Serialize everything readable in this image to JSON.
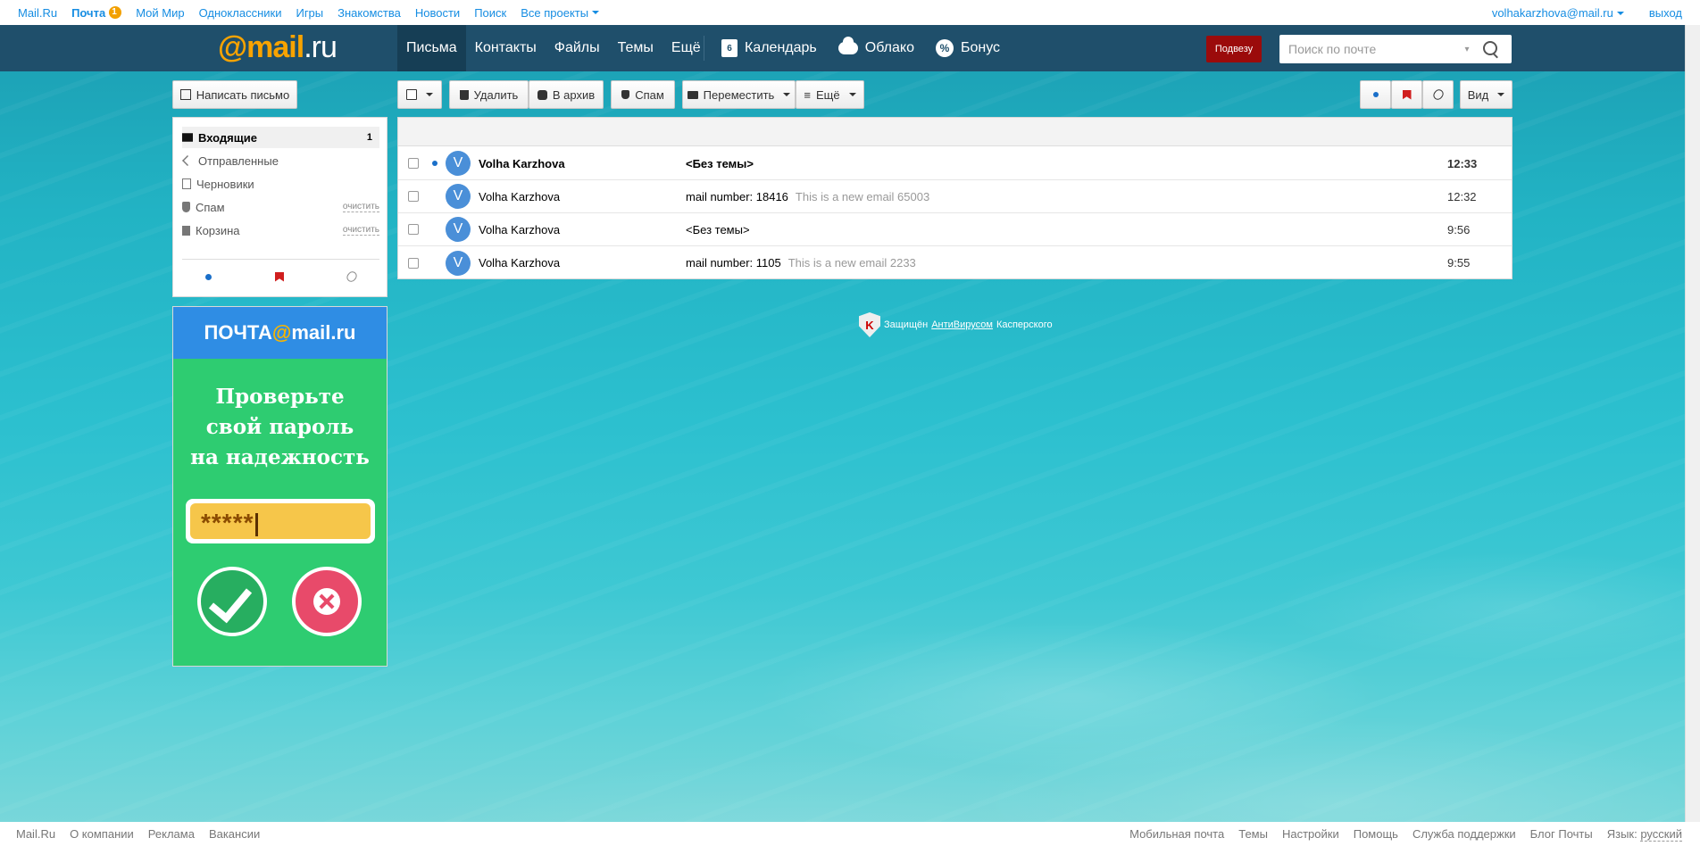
{
  "portal": {
    "links": [
      "Mail.Ru",
      "Почта",
      "Мой Мир",
      "Одноклассники",
      "Игры",
      "Знакомства",
      "Новости",
      "Поиск",
      "Все проекты"
    ],
    "mail_badge": "1",
    "user_email": "volhakarzhova@mail.ru",
    "logout": "выход"
  },
  "header": {
    "logo_mail": "mail",
    "logo_at": "@",
    "logo_ru": ".ru",
    "tabs": [
      "Письма",
      "Контакты",
      "Файлы",
      "Темы",
      "Ещё"
    ],
    "calendar": "Календарь",
    "calendar_day": "6",
    "cloud": "Облако",
    "bonus": "Бонус",
    "podvezu": "Подвезу",
    "search_placeholder": "Поиск по почте"
  },
  "toolbar": {
    "compose": "Написать письмо",
    "delete": "Удалить",
    "archive": "В архив",
    "spam": "Спам",
    "move": "Переместить",
    "more": "Ещё",
    "view": "Вид"
  },
  "folders": [
    {
      "label": "Входящие",
      "count": "1"
    },
    {
      "label": "Отправленные"
    },
    {
      "label": "Черновики"
    },
    {
      "label": "Спам",
      "action": "очистить"
    },
    {
      "label": "Корзина",
      "action": "очистить"
    }
  ],
  "ad": {
    "brand_left": "ПОЧТА",
    "brand_at": "@",
    "brand_right": "mail.ru",
    "line1": "Проверьте",
    "line2": "свой пароль",
    "line3": "на надежность",
    "password": "*****"
  },
  "messages": [
    {
      "avatar": "V",
      "from": "Volha Karzhova",
      "subject": "<Без темы>",
      "snippet": "",
      "time": "12:33",
      "unread": true
    },
    {
      "avatar": "V",
      "from": "Volha Karzhova",
      "subject": "mail number: 18416",
      "snippet": "This is a new email 65003",
      "time": "12:32",
      "unread": false
    },
    {
      "avatar": "V",
      "from": "Volha Karzhova",
      "subject": "<Без темы>",
      "snippet": "",
      "time": "9:56",
      "unread": false
    },
    {
      "avatar": "V",
      "from": "Volha Karzhova",
      "subject": "mail number: 1105",
      "snippet": "This is a new email 2233",
      "time": "9:55",
      "unread": false
    }
  ],
  "kaspersky": {
    "pre": "Защищён",
    "link": "АнтиВирусом",
    "post": "Касперского",
    "logo_letter": "K"
  },
  "footer": {
    "left": [
      "Mail.Ru",
      "О компании",
      "Реклама",
      "Вакансии"
    ],
    "right": [
      "Мобильная почта",
      "Темы",
      "Настройки",
      "Помощь",
      "Служба поддержки",
      "Блог Почты"
    ],
    "lang_label": "Язык:",
    "lang": "русский"
  },
  "colors": {
    "header_bg": "#1f4f6b",
    "accent_blue": "#168de2",
    "logo_orange": "#f8a300",
    "podvezu_red": "#9b0b0b",
    "unread_dot": "#1a6fc9"
  }
}
